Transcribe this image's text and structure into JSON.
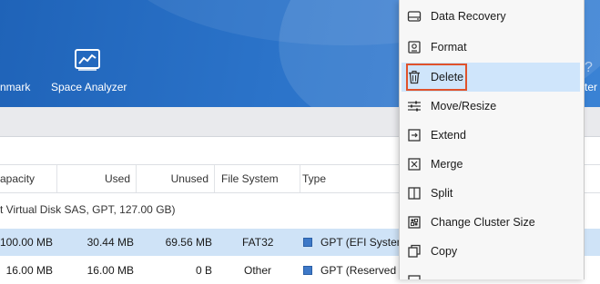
{
  "toolbar": {
    "partial_left_label": "nmark",
    "space_analyzer_label": "Space Analyzer",
    "partial_right_label": "ter",
    "partial_right_icon": "?"
  },
  "table": {
    "headers": [
      "apacity",
      "Used",
      "Unused",
      "File System",
      "Type"
    ],
    "disk_label": "t Virtual Disk SAS, GPT, 127.00 GB)",
    "rows": [
      {
        "capacity": "100.00 MB",
        "used": "30.44 MB",
        "unused": "69.56 MB",
        "fs": "FAT32",
        "type": "GPT (EFI System"
      },
      {
        "capacity": "16.00 MB",
        "used": "16.00 MB",
        "unused": "0 B",
        "fs": "Other",
        "type": "GPT (Reserved Pa"
      }
    ]
  },
  "context_menu": {
    "items": [
      {
        "label": "Data Recovery",
        "icon": "disk-recovery-icon"
      },
      {
        "label": "Format",
        "icon": "format-icon"
      },
      {
        "label": "Delete",
        "icon": "trash-icon"
      },
      {
        "label": "Move/Resize",
        "icon": "sliders-icon"
      },
      {
        "label": "Extend",
        "icon": "extend-icon"
      },
      {
        "label": "Merge",
        "icon": "merge-icon"
      },
      {
        "label": "Split",
        "icon": "split-icon"
      },
      {
        "label": "Change Cluster Size",
        "icon": "cluster-icon"
      },
      {
        "label": "Copy",
        "icon": "copy-icon"
      }
    ],
    "highlighted": "Delete"
  },
  "colors": {
    "banner": "#2b73c9",
    "selection": "#cfe3f7",
    "menu_highlight": "#cfe5fb",
    "annotation_box": "#e0522b",
    "partition_swatch": "#3e79c8"
  }
}
